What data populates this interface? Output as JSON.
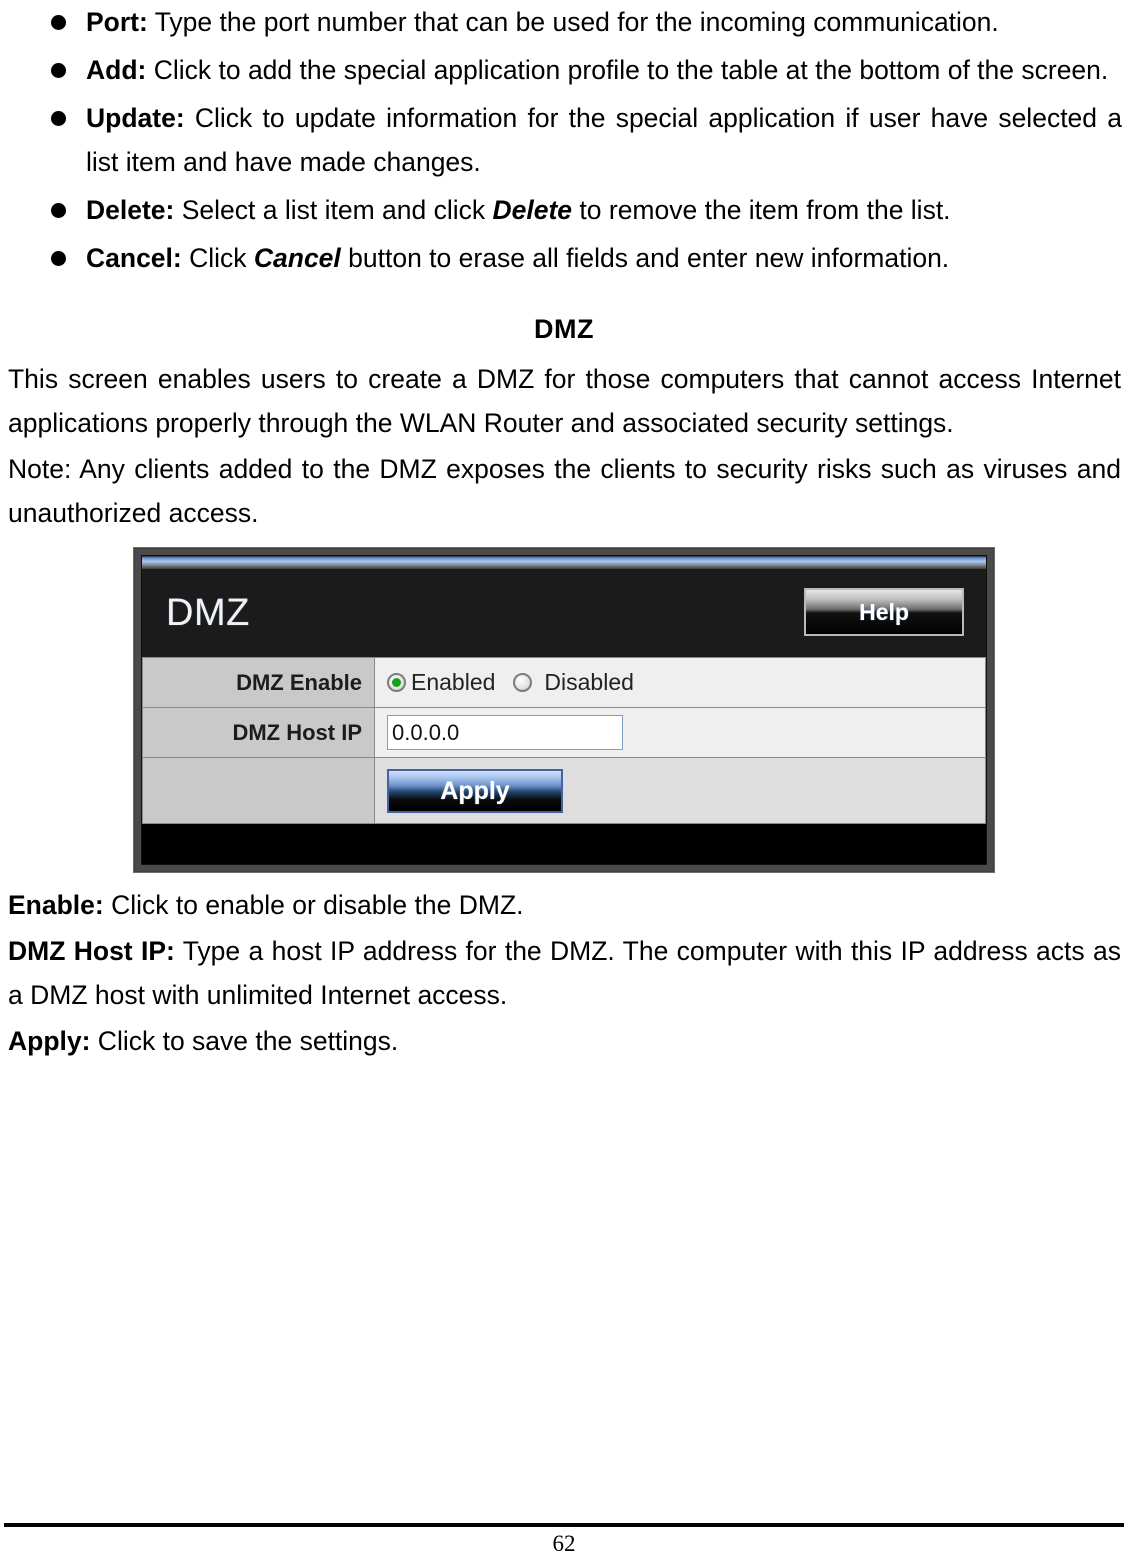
{
  "bullets": [
    {
      "term": "Port:",
      "text": " Type the port number that can be used for the incoming communication."
    },
    {
      "term": "Add:",
      "text": " Click to add the special application profile to the table at the bottom of the screen."
    },
    {
      "term": "Update:",
      "text": " Click to update information for the special application if user have selected a list item and have made changes."
    },
    {
      "term": "Delete:",
      "pre": " Select a list item and click ",
      "em": "Delete",
      "post": " to remove the item from the list."
    },
    {
      "term": "Cancel:",
      "pre": " Click ",
      "em": "Cancel",
      "post": " button to erase all fields and enter new information."
    }
  ],
  "section": {
    "heading": "DMZ",
    "intro": "This screen enables users to create a DMZ for those computers that cannot access Internet applications properly through the WLAN Router and associated security settings.",
    "note": "Note: Any clients added to the DMZ exposes the clients to security risks such as viruses and unauthorized access."
  },
  "screenshot": {
    "title": "DMZ",
    "help_label": "Help",
    "rows": [
      {
        "label": "DMZ Enable",
        "type": "radio"
      },
      {
        "label": "DMZ Host IP",
        "type": "input",
        "value": "0.0.0.0"
      },
      {
        "label": "",
        "type": "button"
      }
    ],
    "radio_options": [
      {
        "label": "Enabled",
        "checked": true
      },
      {
        "label": "Disabled",
        "checked": false
      }
    ],
    "apply_label": "Apply",
    "colors": {
      "header_bg": "#1b1b1b",
      "topbar_accent": "#a9caf4",
      "label_cell_bg": "#c9c9c9",
      "value_cell_bg": "#efefef",
      "apply_border": "#43629e",
      "radio_dot": "#19a119"
    }
  },
  "definitions": [
    {
      "term": "Enable:",
      "text": " Click to enable or disable the DMZ."
    },
    {
      "term": "DMZ Host IP:",
      "text": " Type a host IP address for the DMZ. The computer with this IP address acts as a DMZ host with unlimited Internet access."
    },
    {
      "term": "Apply:",
      "text": " Click to save the settings."
    }
  ],
  "footer": {
    "page_number": "62"
  }
}
